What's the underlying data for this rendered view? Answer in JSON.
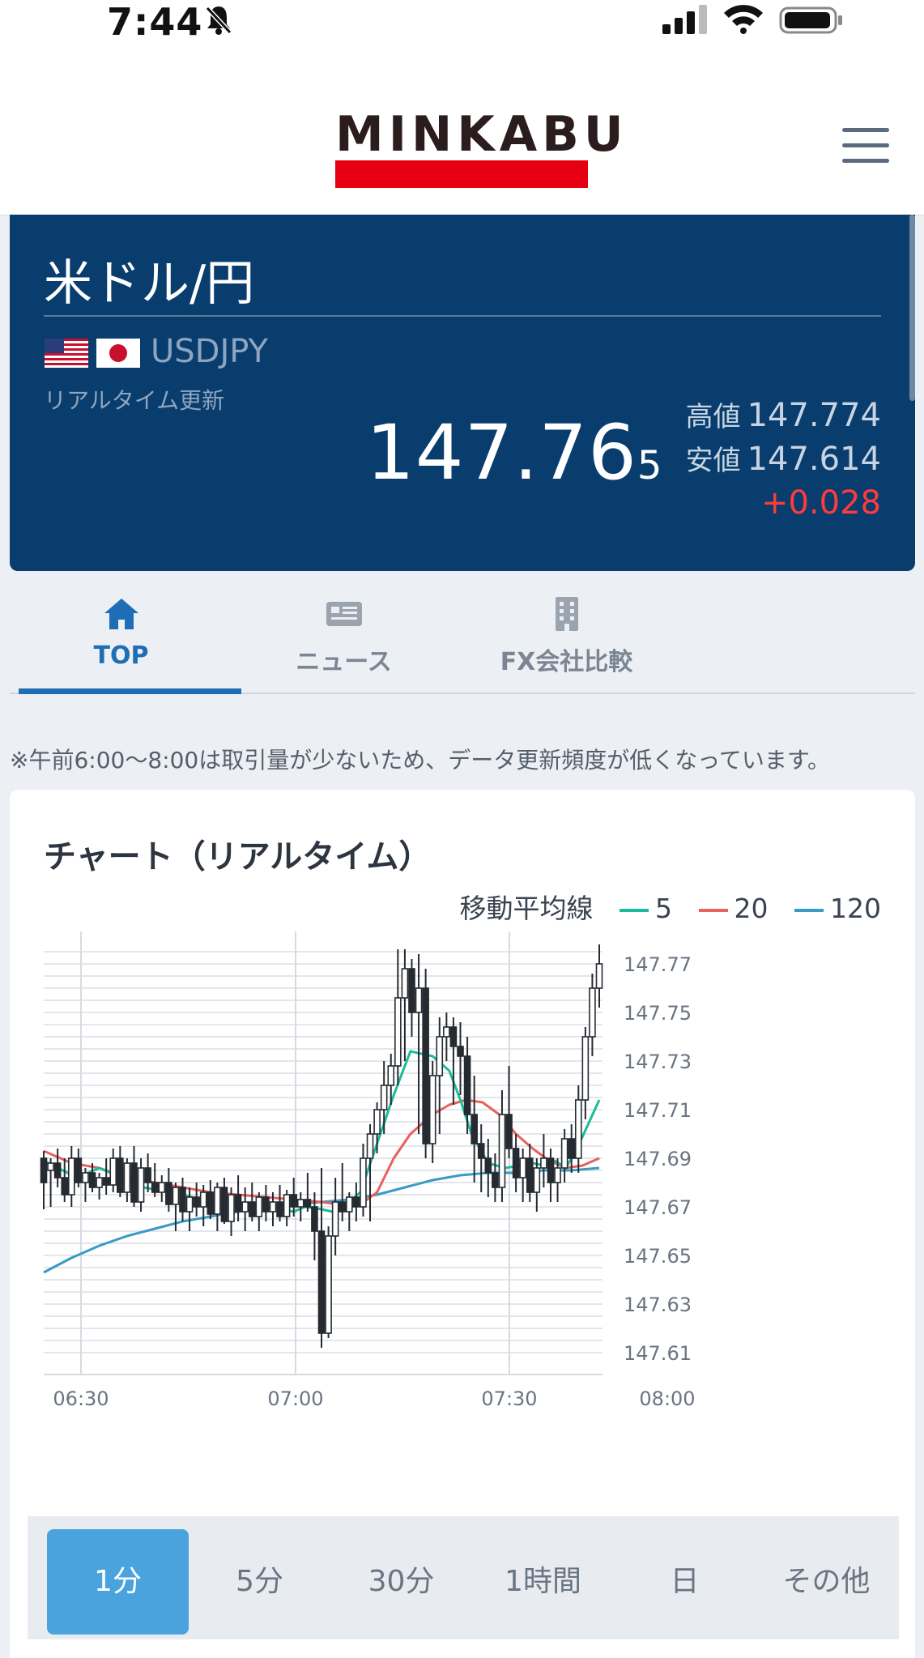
{
  "status_bar": {
    "time": "7:44"
  },
  "header": {
    "logo_text": "MINKABU"
  },
  "quote": {
    "pair_name": "米ドル/円",
    "pair_code": "USDJPY",
    "update_label": "リアルタイム更新",
    "price_main": "147.76",
    "price_small": "5",
    "high_label": "高値",
    "high_value": "147.774",
    "low_label": "安値",
    "low_value": "147.614",
    "change": "+0.028"
  },
  "tabs": [
    {
      "label": "TOP",
      "icon": "home-icon",
      "active": true
    },
    {
      "label": "ニュース",
      "icon": "newspaper-icon",
      "active": false
    },
    {
      "label": "FX会社比較",
      "icon": "building-icon",
      "active": false
    }
  ],
  "notice": "※午前6:00〜8:00は取引量が少ないため、データ更新頻度が低くなっています。",
  "chart": {
    "title": "チャート（リアルタイム）",
    "legend_title": "移動平均線",
    "legend": [
      {
        "label": "5",
        "color": "#1abc9c"
      },
      {
        "label": "20",
        "color": "#e8615c"
      },
      {
        "label": "120",
        "color": "#3a9bc4"
      }
    ]
  },
  "chart_data": {
    "type": "candlestick",
    "x_ticks": [
      "06:30",
      "07:00",
      "07:30",
      "08:00"
    ],
    "y_ticks": [
      "147.77",
      "147.75",
      "147.73",
      "147.71",
      "147.69",
      "147.67",
      "147.65",
      "147.63",
      "147.61"
    ],
    "ylim": [
      147.605,
      147.78
    ],
    "grid": true,
    "candles_ohlc": [
      [
        147.69,
        147.693,
        147.669,
        147.68
      ],
      [
        147.685,
        147.69,
        147.67,
        147.688
      ],
      [
        147.688,
        147.694,
        147.678,
        147.682
      ],
      [
        147.682,
        147.69,
        147.672,
        147.675
      ],
      [
        147.675,
        147.695,
        147.67,
        147.69
      ],
      [
        147.69,
        147.694,
        147.678,
        147.68
      ],
      [
        147.68,
        147.686,
        147.672,
        147.684
      ],
      [
        147.684,
        147.688,
        147.676,
        147.678
      ],
      [
        147.678,
        147.684,
        147.673,
        147.682
      ],
      [
        147.682,
        147.69,
        147.675,
        147.679
      ],
      [
        147.679,
        147.694,
        147.676,
        147.69
      ],
      [
        147.69,
        147.695,
        147.674,
        147.676
      ],
      [
        147.676,
        147.69,
        147.672,
        147.688
      ],
      [
        147.688,
        147.695,
        147.67,
        147.672
      ],
      [
        147.672,
        147.69,
        147.668,
        147.686
      ],
      [
        147.686,
        147.692,
        147.676,
        147.68
      ],
      [
        147.68,
        147.688,
        147.674,
        147.676
      ],
      [
        147.676,
        147.683,
        147.672,
        147.68
      ],
      [
        147.68,
        147.686,
        147.668,
        147.671
      ],
      [
        147.671,
        147.68,
        147.66,
        147.678
      ],
      [
        147.678,
        147.682,
        147.664,
        147.668
      ],
      [
        147.668,
        147.678,
        147.66,
        147.674
      ],
      [
        147.674,
        147.68,
        147.666,
        147.67
      ],
      [
        147.67,
        147.679,
        147.662,
        147.676
      ],
      [
        147.676,
        147.681,
        147.665,
        147.667
      ],
      [
        147.667,
        147.68,
        147.66,
        147.678
      ],
      [
        147.678,
        147.682,
        147.663,
        147.664
      ],
      [
        147.664,
        147.678,
        147.658,
        147.675
      ],
      [
        147.675,
        147.683,
        147.664,
        147.668
      ],
      [
        147.668,
        147.678,
        147.66,
        147.672
      ],
      [
        147.672,
        147.68,
        147.664,
        147.666
      ],
      [
        147.666,
        147.676,
        147.66,
        147.674
      ],
      [
        147.674,
        147.679,
        147.664,
        147.668
      ],
      [
        147.668,
        147.676,
        147.662,
        147.672
      ],
      [
        147.672,
        147.679,
        147.664,
        147.666
      ],
      [
        147.666,
        147.677,
        147.662,
        147.675
      ],
      [
        147.675,
        147.682,
        147.666,
        147.67
      ],
      [
        147.67,
        147.676,
        147.664,
        147.673
      ],
      [
        147.673,
        147.684,
        147.668,
        147.67
      ],
      [
        147.67,
        147.676,
        147.648,
        147.66
      ],
      [
        147.66,
        147.686,
        147.612,
        147.618
      ],
      [
        147.618,
        147.662,
        147.616,
        147.658
      ],
      [
        147.658,
        147.682,
        147.65,
        147.672
      ],
      [
        147.672,
        147.688,
        147.664,
        147.668
      ],
      [
        147.668,
        147.676,
        147.66,
        147.674
      ],
      [
        147.674,
        147.68,
        147.664,
        147.67
      ],
      [
        147.67,
        147.696,
        147.666,
        147.69
      ],
      [
        147.69,
        147.704,
        147.664,
        147.7
      ],
      [
        147.7,
        147.713,
        147.692,
        147.71
      ],
      [
        147.71,
        147.73,
        147.7,
        147.72
      ],
      [
        147.72,
        147.733,
        147.712,
        147.728
      ],
      [
        147.728,
        147.776,
        147.72,
        147.756
      ],
      [
        147.756,
        147.776,
        147.73,
        147.768
      ],
      [
        147.768,
        147.772,
        147.74,
        147.75
      ],
      [
        147.75,
        147.774,
        147.7,
        147.76
      ],
      [
        147.76,
        147.768,
        147.69,
        147.696
      ],
      [
        147.696,
        147.73,
        147.688,
        147.724
      ],
      [
        147.724,
        147.748,
        147.7,
        147.74
      ],
      [
        147.74,
        147.75,
        147.73,
        147.744
      ],
      [
        147.744,
        147.748,
        147.712,
        147.736
      ],
      [
        147.736,
        147.746,
        147.716,
        147.732
      ],
      [
        147.732,
        147.74,
        147.7,
        147.708
      ],
      [
        147.708,
        147.724,
        147.68,
        147.696
      ],
      [
        147.696,
        147.704,
        147.676,
        147.69
      ],
      [
        147.69,
        147.698,
        147.674,
        147.684
      ],
      [
        147.684,
        147.692,
        147.672,
        147.678
      ],
      [
        147.678,
        147.718,
        147.672,
        147.708
      ],
      [
        147.708,
        147.728,
        147.69,
        147.694
      ],
      [
        147.694,
        147.7,
        147.676,
        147.682
      ],
      [
        147.682,
        147.694,
        147.672,
        147.69
      ],
      [
        147.69,
        147.696,
        147.672,
        147.676
      ],
      [
        147.676,
        147.69,
        147.668,
        147.686
      ],
      [
        147.686,
        147.7,
        147.678,
        147.69
      ],
      [
        147.69,
        147.694,
        147.672,
        147.68
      ],
      [
        147.68,
        147.69,
        147.672,
        147.686
      ],
      [
        147.686,
        147.702,
        147.68,
        147.698
      ],
      [
        147.698,
        147.704,
        147.684,
        147.69
      ],
      [
        147.69,
        147.72,
        147.684,
        147.714
      ],
      [
        147.714,
        147.744,
        147.706,
        147.74
      ],
      [
        147.74,
        147.766,
        147.732,
        147.76
      ],
      [
        147.76,
        147.778,
        147.752,
        147.77
      ]
    ],
    "ma5_points": [
      [
        0,
        147.689
      ],
      [
        0.06,
        147.682
      ],
      [
        0.1,
        147.686
      ],
      [
        0.18,
        147.678
      ],
      [
        0.25,
        147.675
      ],
      [
        0.3,
        147.672
      ],
      [
        0.38,
        147.671
      ],
      [
        0.45,
        147.668
      ],
      [
        0.47,
        147.67
      ],
      [
        0.5,
        147.669
      ],
      [
        0.52,
        147.668
      ],
      [
        0.55,
        147.672
      ],
      [
        0.57,
        147.676
      ],
      [
        0.6,
        147.696
      ],
      [
        0.63,
        147.716
      ],
      [
        0.66,
        147.734
      ],
      [
        0.7,
        147.732
      ],
      [
        0.73,
        147.726
      ],
      [
        0.75,
        147.714
      ],
      [
        0.77,
        147.7
      ],
      [
        0.8,
        147.688
      ],
      [
        0.83,
        147.686
      ],
      [
        0.86,
        147.687
      ],
      [
        0.88,
        147.688
      ],
      [
        0.9,
        147.687
      ],
      [
        0.92,
        147.689
      ],
      [
        0.94,
        147.686
      ],
      [
        0.96,
        147.694
      ],
      [
        0.98,
        147.704
      ],
      [
        1.0,
        147.714
      ]
    ],
    "ma20_points": [
      [
        0,
        147.693
      ],
      [
        0.05,
        147.688
      ],
      [
        0.1,
        147.686
      ],
      [
        0.15,
        147.682
      ],
      [
        0.2,
        147.68
      ],
      [
        0.25,
        147.678
      ],
      [
        0.3,
        147.676
      ],
      [
        0.35,
        147.675
      ],
      [
        0.4,
        147.674
      ],
      [
        0.45,
        147.673
      ],
      [
        0.5,
        147.672
      ],
      [
        0.53,
        147.671
      ],
      [
        0.55,
        147.67
      ],
      [
        0.57,
        147.671
      ],
      [
        0.6,
        147.676
      ],
      [
        0.63,
        147.69
      ],
      [
        0.66,
        147.7
      ],
      [
        0.7,
        147.708
      ],
      [
        0.73,
        147.712
      ],
      [
        0.76,
        147.714
      ],
      [
        0.79,
        147.713
      ],
      [
        0.82,
        147.708
      ],
      [
        0.85,
        147.7
      ],
      [
        0.88,
        147.694
      ],
      [
        0.91,
        147.689
      ],
      [
        0.94,
        147.686
      ],
      [
        0.97,
        147.687
      ],
      [
        1.0,
        147.69
      ]
    ],
    "ma120_points": [
      [
        0,
        147.643
      ],
      [
        0.05,
        147.649
      ],
      [
        0.1,
        147.654
      ],
      [
        0.15,
        147.658
      ],
      [
        0.2,
        147.661
      ],
      [
        0.25,
        147.664
      ],
      [
        0.3,
        147.666
      ],
      [
        0.35,
        147.668
      ],
      [
        0.4,
        147.67
      ],
      [
        0.45,
        147.671
      ],
      [
        0.5,
        147.672
      ],
      [
        0.55,
        147.673
      ],
      [
        0.6,
        147.675
      ],
      [
        0.65,
        147.678
      ],
      [
        0.7,
        147.681
      ],
      [
        0.75,
        147.683
      ],
      [
        0.8,
        147.684
      ],
      [
        0.85,
        147.684
      ],
      [
        0.9,
        147.685
      ],
      [
        0.95,
        147.685
      ],
      [
        1.0,
        147.686
      ]
    ]
  },
  "periods": [
    {
      "label": "1分",
      "active": true
    },
    {
      "label": "5分",
      "active": false
    },
    {
      "label": "30分",
      "active": false
    },
    {
      "label": "1時間",
      "active": false
    },
    {
      "label": "日",
      "active": false
    },
    {
      "label": "その他",
      "active": false
    }
  ]
}
